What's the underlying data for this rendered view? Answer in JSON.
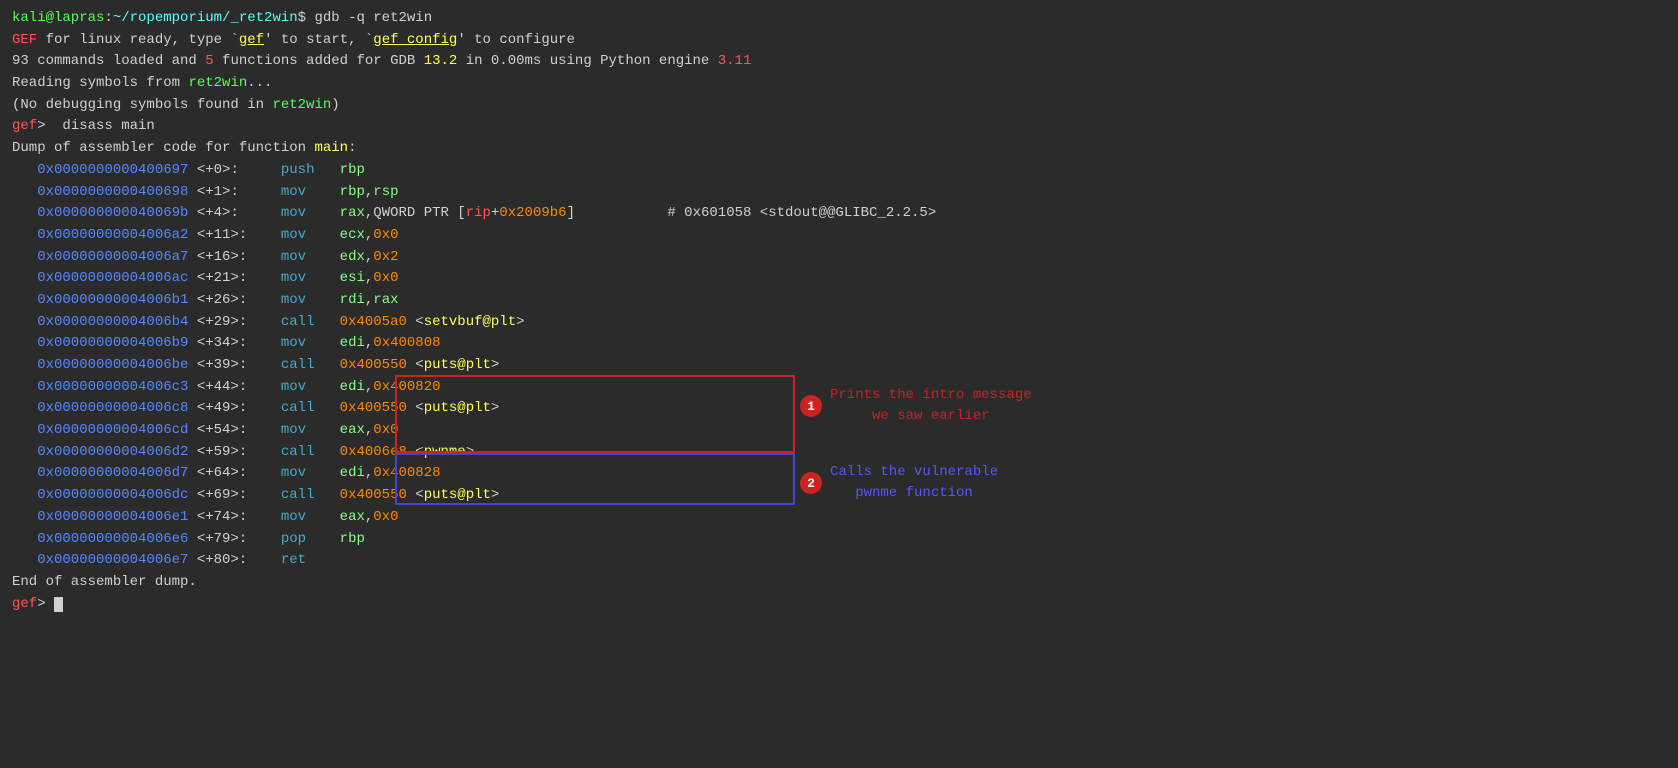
{
  "terminal": {
    "title": "kali@lapras:~/ropemporium/_ret2win",
    "lines": [
      {
        "id": "prompt1",
        "text": "kali@lapras:~/ropemporium/_ret2win$ gdb -q ret2win"
      },
      {
        "id": "gef-banner",
        "parts": [
          {
            "t": "GEF",
            "c": "bright-red"
          },
          {
            "t": " for linux ready, type `",
            "c": "white"
          },
          {
            "t": "gef",
            "c": "bright-yellow"
          },
          {
            "t": "' to start, `",
            "c": "white"
          },
          {
            "t": "gef config",
            "c": "bright-yellow"
          },
          {
            "t": "' to configure",
            "c": "white"
          }
        ]
      },
      {
        "id": "gef-info",
        "text": "93 commands loaded and 5 functions added for GDB 13.2 in 0.00ms using Python engine 3.11"
      },
      {
        "id": "reading-symbols",
        "text": "Reading symbols from ret2win..."
      },
      {
        "id": "no-debug",
        "text": "(No debugging symbols found in ret2win)"
      },
      {
        "id": "gef-prompt",
        "text": "gef>  disass main"
      },
      {
        "id": "dump-header",
        "text": "Dump of assembler code for function main:"
      },
      {
        "id": "asm-0",
        "text": "   0x0000000000400697 <+0>:     push   rbp"
      },
      {
        "id": "asm-1",
        "text": "   0x0000000000400698 <+1>:     mov    rbp,rsp"
      },
      {
        "id": "asm-4",
        "text": "   0x000000000040069b <+4>:     mov    rax,QWORD PTR [rip+0x2009b6]"
      },
      {
        "id": "asm-11",
        "text": "   0x00000000004006a2 <+11>:    mov    ecx,0x0"
      },
      {
        "id": "asm-16",
        "text": "   0x00000000004006a7 <+16>:    mov    edx,0x2"
      },
      {
        "id": "asm-21",
        "text": "   0x00000000004006ac <+21>:    mov    esi,0x0"
      },
      {
        "id": "asm-26",
        "text": "   0x00000000004006b1 <+26>:    mov    rdi,rax"
      },
      {
        "id": "asm-29",
        "text": "   0x00000000004006b4 <+29>:    call   0x4005a0 <setvbuf@plt>"
      },
      {
        "id": "asm-34",
        "text": "   0x00000000004006b9 <+34>:    mov    edi,0x400808"
      },
      {
        "id": "asm-39",
        "text": "   0x00000000004006be <+39>:    call   0x400550 <puts@plt>"
      },
      {
        "id": "asm-44",
        "text": "   0x00000000004006c3 <+44>:    mov    edi,0x400820"
      },
      {
        "id": "asm-49",
        "text": "   0x00000000004006c8 <+49>:    call   0x400550 <puts@plt>"
      },
      {
        "id": "asm-54",
        "text": "   0x00000000004006cd <+54>:    mov    eax,0x0"
      },
      {
        "id": "asm-59",
        "text": "   0x00000000004006d2 <+59>:    call   0x4006e8 <pwnme>"
      },
      {
        "id": "asm-64",
        "text": "   0x00000000004006d7 <+64>:    mov    edi,0x400828"
      },
      {
        "id": "asm-69",
        "text": "   0x00000000004006dc <+69>:    call   0x400550 <puts@plt>"
      },
      {
        "id": "asm-74",
        "text": "   0x00000000004006e1 <+74>:    mov    eax,0x0"
      },
      {
        "id": "asm-79",
        "text": "   0x00000000004006e6 <+79>:    pop    rbp"
      },
      {
        "id": "asm-80",
        "text": "   0x00000000004006e7 <+80>:    ret"
      },
      {
        "id": "end-dump",
        "text": "End of assembler dump."
      },
      {
        "id": "gef-prompt2",
        "text": "gef> "
      }
    ],
    "annotation1_badge": "1",
    "annotation1_line1": "Prints the intro message",
    "annotation1_line2": "we saw earlier",
    "annotation2_badge": "2",
    "annotation2_line1": "Calls the vulnerable",
    "annotation2_line2": "pwnme function"
  }
}
